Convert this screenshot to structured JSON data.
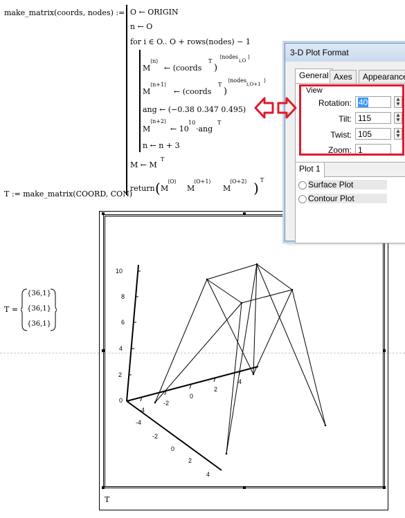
{
  "program": {
    "signature": "make_matrix(coords, nodes) :=",
    "lines": {
      "l1": "O ← ORIGIN",
      "l2": "n ← O",
      "l3": "for  i ∈ O.. O + rows(nodes) − 1",
      "m1a": "M",
      "m1sup": "⟨n⟩",
      "m1b": "← (coords",
      "m1T": "T",
      "m1c": ")",
      "m1sup2": "⟨nodes",
      "m1sub": "i,O",
      "m1close": "⟩",
      "m2a": "M",
      "m2sup": "⟨n+1⟩",
      "m2b": "← (coords",
      "m2T": "T",
      "m2c": ")",
      "m2sup2": "⟨nodes",
      "m2sub": "i,O+1",
      "m2close": "⟩",
      "ang": "ang ← (−0.38   0.347   0.495)",
      "m3a": "M",
      "m3sup": "⟨n+2⟩",
      "m3b": "← 10",
      "m3exp": "10",
      "m3c": "·ang",
      "m3T": "T",
      "nn": "n ← n + 3",
      "mt": "M ← M",
      "mtT": "T",
      "ret": "return",
      "r1": "M",
      "r1s": "⟨O⟩",
      "r2": "M",
      "r2s": "⟨O+1⟩",
      "r3": "M",
      "r3s": "⟨O+2⟩",
      "rT": "T"
    }
  },
  "assignment": "T := make_matrix(COORD, CON)",
  "result": {
    "lhs": "T =",
    "cells": [
      "{36,1}",
      "{36,1}",
      "{36,1}"
    ]
  },
  "plot": {
    "footer_label": "T",
    "z_ticks": [
      "10",
      "8",
      "6",
      "4",
      "2",
      "0"
    ],
    "x_ticks": [
      "-4",
      "-2",
      "0",
      "2",
      "4"
    ],
    "y_ticks": [
      "-4",
      "-2",
      "0",
      "2",
      "4"
    ]
  },
  "dialog": {
    "title": "3-D Plot Format",
    "tabs": [
      "General",
      "Axes",
      "Appearance"
    ],
    "view_group": "View",
    "fields": [
      {
        "label": "Rotation:",
        "value": "40"
      },
      {
        "label": "Tilt:",
        "value": "115"
      },
      {
        "label": "Twist:",
        "value": "105"
      },
      {
        "label": "Zoom:",
        "value": "1"
      }
    ],
    "plot_tab": "Plot 1",
    "surface_plot": "Surface Plot",
    "contour_plot": "Contour Plot"
  },
  "annotation_color": "#e0192b"
}
